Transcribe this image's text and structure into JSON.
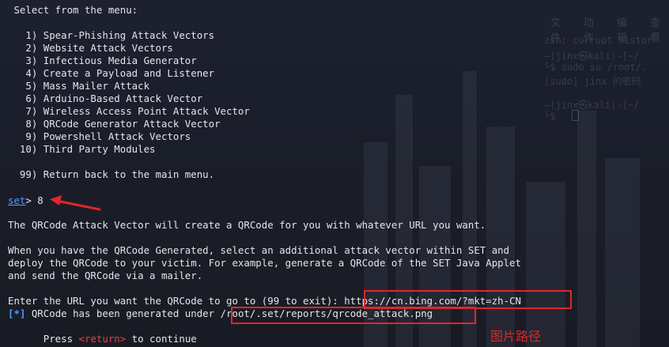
{
  "terminal": {
    "menu_prompt": " Select from the menu:",
    "menu_items": [
      "   1) Spear-Phishing Attack Vectors",
      "   2) Website Attack Vectors",
      "   3) Infectious Media Generator",
      "   4) Create a Payload and Listener",
      "   5) Mass Mailer Attack",
      "   6) Arduino-Based Attack Vector",
      "   7) Wireless Access Point Attack Vector",
      "   8) QRCode Generator Attack Vector",
      "   9) Powershell Attack Vectors",
      "  10) Third Party Modules"
    ],
    "return_item": "  99) Return back to the main menu.",
    "prompt_label": "set",
    "prompt_suffix": "> 8",
    "description": "The QRCode Attack Vector will create a QRCode for you with whatever URL you want.",
    "info_lines": [
      "When you have the QRCode Generated, select an additional attack vector within SET and",
      "deploy the QRCode to your victim. For example, generate a QRCode of the SET Java Applet",
      "and send the QRCode via a mailer."
    ],
    "url_prompt": "Enter the URL you want the QRCode to go to (99 to exit): ",
    "url_value": "https://cn.bing.com/?mkt=zh-CN",
    "status_marker": "[*]",
    "status_text": " QRCode has been generated under ",
    "status_path": "/root/.set/reports/qrcode_attack.png",
    "continue_prefix": "      Press ",
    "continue_key": "<return>",
    "continue_suffix": " to continue"
  },
  "annotation": {
    "label": "图片路径",
    "color": "#e0262a"
  },
  "background_window": {
    "menu": [
      "文件",
      "动作",
      "编辑",
      "查看"
    ],
    "lines": [
      "zsh: corrupt histor",
      "—(jinx㉿kali)-[~/",
      "└$ sudo su /root/.",
      "[sudo] jinx 的密码",
      "—(jinx㉿kali)-[~/",
      "└$ "
    ]
  },
  "colors": {
    "prompt_blue": "#4f9dff",
    "highlight_red": "#e0262a",
    "text": "#e4e6ea",
    "background": "#1b1e2a"
  }
}
